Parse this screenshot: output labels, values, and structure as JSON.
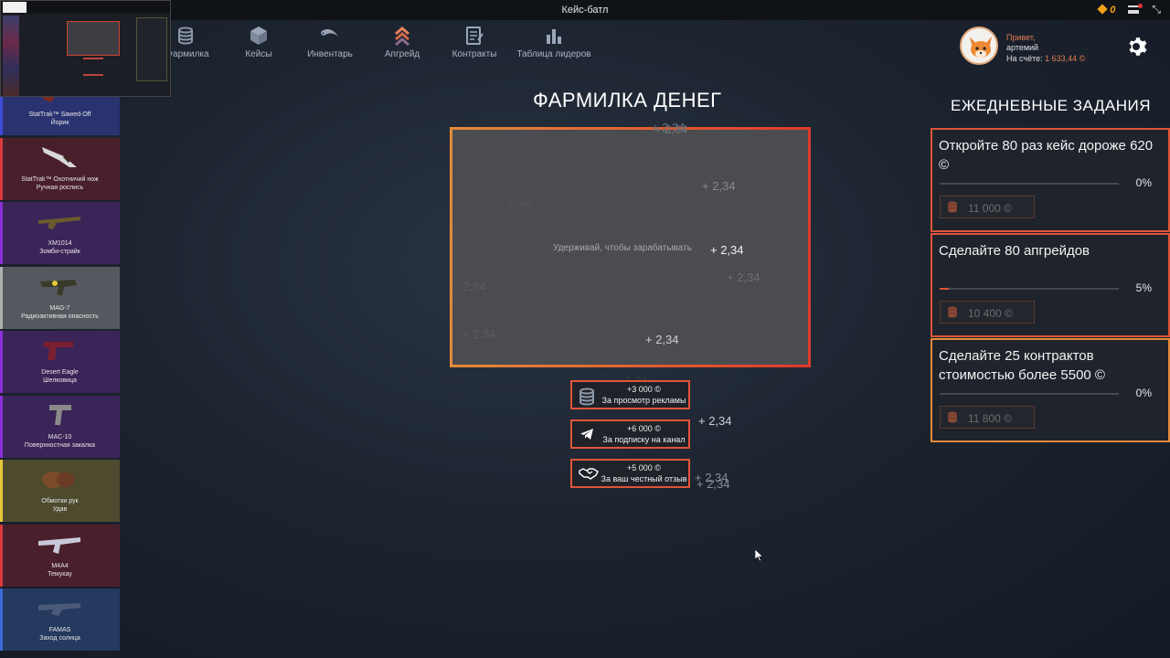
{
  "window": {
    "title": "Кейс-батл",
    "coins": "0"
  },
  "nav": [
    {
      "label": "Фармилка",
      "icon": "coins-stack-icon"
    },
    {
      "label": "Кейсы",
      "icon": "box-icon"
    },
    {
      "label": "Инвентарь",
      "icon": "karambit-icon"
    },
    {
      "label": "Апгрейд",
      "icon": "upgrade-chevrons-icon"
    },
    {
      "label": "Контракты",
      "icon": "contract-icon"
    },
    {
      "label": "Таблица лидеров",
      "icon": "bar-chart-icon"
    }
  ],
  "profile": {
    "greeting": "Привет,",
    "username": "артемий",
    "balance_label": "На счёте:",
    "balance_value": "1 633,44 ©"
  },
  "drops": [
    {
      "name": "StatTrak™ Sawed-Off",
      "skin": "Йорик",
      "color": "#3d4bd6",
      "bg": "#2a3370"
    },
    {
      "name": "StatTrak™ Охотничий нож",
      "skin": "Ручная роспись",
      "color": "#d93a3a",
      "bg": "#4a1f2c"
    },
    {
      "name": "XM1014",
      "skin": "Зомби-страйк",
      "color": "#8a2fd6",
      "bg": "#3b2458"
    },
    {
      "name": "MAG-7",
      "skin": "Радиоактивная опасность",
      "color": "#b0b0b0",
      "bg": "#55595f"
    },
    {
      "name": "Desert Eagle",
      "skin": "Шелковица",
      "color": "#8a2fd6",
      "bg": "#3b2458"
    },
    {
      "name": "MAC-10",
      "skin": "Поверхностная закалка",
      "color": "#8a2fd6",
      "bg": "#3b2458"
    },
    {
      "name": "Обмотки рук",
      "skin": "Удав",
      "color": "#e6c53a",
      "bg": "#4d4a2e"
    },
    {
      "name": "M4A4",
      "skin": "Темукау",
      "color": "#d93a3a",
      "bg": "#4a1f2c"
    },
    {
      "name": "FAMAS",
      "skin": "Заход солнца",
      "color": "#3d6bd6",
      "bg": "#243a5e"
    }
  ],
  "farm": {
    "title": "ФАРМИЛКА ДЕНЕГ",
    "hint": "Удерживай, чтобы зарабатывать",
    "floating": "+ 2,34",
    "floating_short": "2,34",
    "floating_overlap": "+ 2,34"
  },
  "actions": [
    {
      "amount": "+3 000 ©",
      "label": "За просмотр рекламы",
      "icon": "coins-stack-icon"
    },
    {
      "amount": "+6 000 ©",
      "label": "За подписку на канал",
      "icon": "telegram-icon"
    },
    {
      "amount": "+5 000 ©",
      "label": "За ваш честный отзыв",
      "icon": "handshake-icon"
    }
  ],
  "tasks_title": "ЕЖЕДНЕВНЫЕ ЗАДАНИЯ",
  "tasks": [
    {
      "text": "Откройте 80 раз кейс дороже 620 ©",
      "progress": 0,
      "percent": "0%",
      "reward": "11 000 ©",
      "border": "#e0553a"
    },
    {
      "text": "Сделайте 80 апгрейдов",
      "progress": 0.05,
      "percent": "5%",
      "reward": "10 400 ©",
      "border": "#e0553a"
    },
    {
      "text": "Сделайте 25 контрактов стоимостью более 5500 ©",
      "progress": 0,
      "percent": "0%",
      "reward": "11 800 ©",
      "border": "#e58a3a"
    }
  ]
}
